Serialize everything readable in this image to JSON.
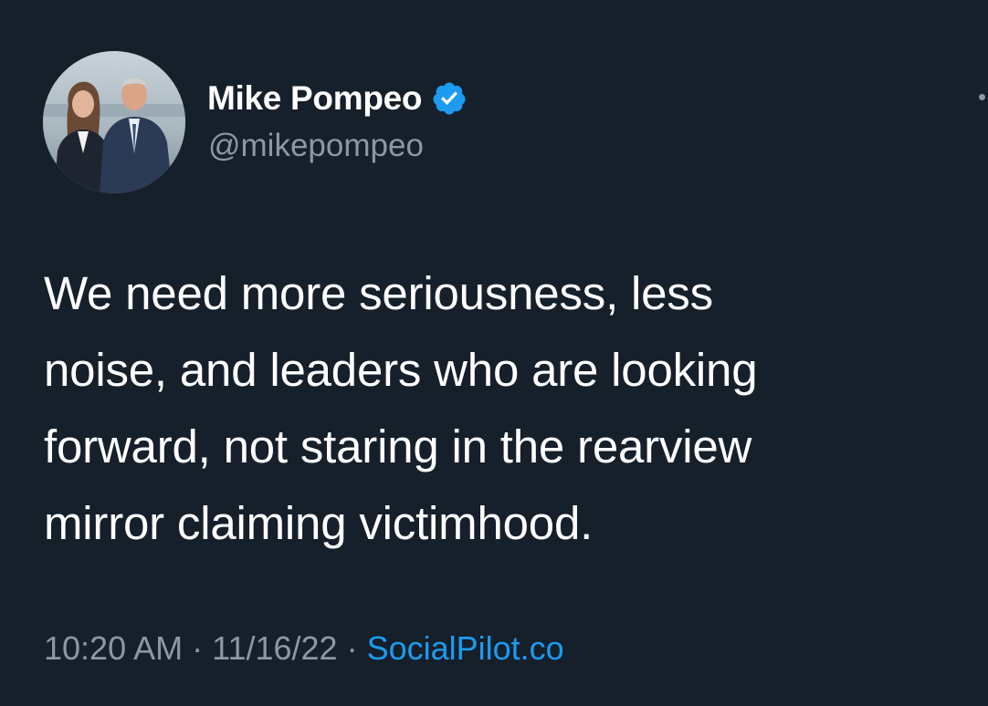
{
  "tweet": {
    "author": {
      "display_name": "Mike Pompeo",
      "handle": "@mikepompeo",
      "verified": true,
      "verified_color": "#1d9bf0"
    },
    "text_lines": [
      "We need more seriousness, less",
      "noise, and leaders who are looking",
      "forward, not staring in the rearview",
      "mirror claiming victimhood."
    ],
    "time": "10:20 AM",
    "date": "11/16/22",
    "separator": "·",
    "source": "SocialPilot.co"
  },
  "colors": {
    "background": "#15202b",
    "text_primary": "#ffffff",
    "text_secondary": "#8b98a5",
    "link": "#1d9bf0"
  },
  "icons": {
    "verified": "verified-badge-icon",
    "more": "more-options-icon"
  }
}
